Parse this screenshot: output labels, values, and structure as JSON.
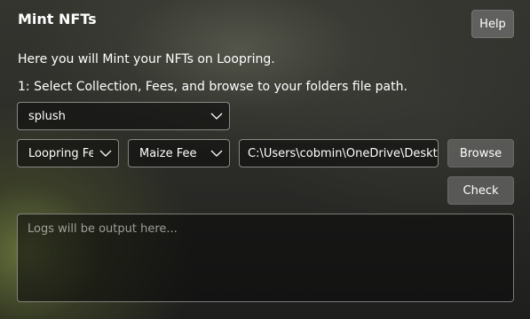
{
  "header": {
    "title": "Mint NFTs",
    "help_label": "Help"
  },
  "intro": {
    "line1": "Here you will Mint your NFTs on Loopring.",
    "line2": "1: Select Collection, Fees, and browse to your folders file path."
  },
  "form": {
    "collection": {
      "selected": "splush",
      "icon": "chevron-down-icon"
    },
    "loopring_fee": {
      "selected": "Loopring Fee",
      "icon": "chevron-down-icon"
    },
    "maize_fee": {
      "selected": "Maize Fee",
      "icon": "chevron-down-icon"
    },
    "path": {
      "value": "C:\\Users\\cobmin\\OneDrive\\Desktop"
    },
    "browse_label": "Browse",
    "check_label": "Check"
  },
  "logs": {
    "placeholder": "Logs will be output here..."
  },
  "colors": {
    "text": "#ffffff",
    "button_bg": "#5c5c5a",
    "field_border": "#d2d2cd"
  }
}
